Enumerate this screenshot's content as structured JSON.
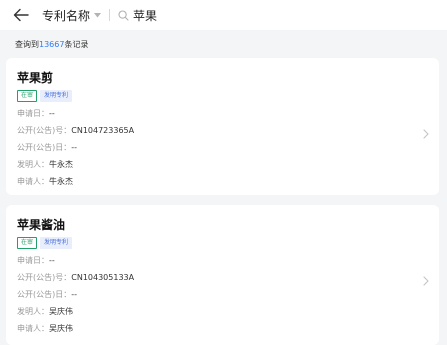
{
  "header": {
    "field_label": "专利名称",
    "search_value": "苹果"
  },
  "results": {
    "prefix": "查询到",
    "count": "13667",
    "suffix": "条记录"
  },
  "cards": [
    {
      "title": "苹果剪",
      "status_tag": "在审",
      "type_tag": "发明专利",
      "fields": [
        {
          "label": "申请日：",
          "value": "--"
        },
        {
          "label": "公开(公告)号：",
          "value": "CN104723365A"
        },
        {
          "label": "公开(公告)日：",
          "value": "--"
        },
        {
          "label": "发明人：",
          "value": "牛永杰"
        },
        {
          "label": "申请人：",
          "value": "牛永杰"
        }
      ]
    },
    {
      "title": "苹果酱油",
      "status_tag": "在审",
      "type_tag": "发明专利",
      "fields": [
        {
          "label": "申请日：",
          "value": "--"
        },
        {
          "label": "公开(公告)号：",
          "value": "CN104305133A"
        },
        {
          "label": "公开(公告)日：",
          "value": "--"
        },
        {
          "label": "发明人：",
          "value": "吴庆伟"
        },
        {
          "label": "申请人：",
          "value": "吴庆伟"
        }
      ]
    }
  ],
  "colors": {
    "accent": "#2f7cf6",
    "status_green": "#22a06b",
    "type_blue": "#4a6fd6",
    "type_bg": "#e8eefc"
  },
  "icons": {
    "back": "arrow-left-icon",
    "caret": "caret-down-icon",
    "search": "search-icon",
    "chevron": "chevron-right-icon"
  }
}
